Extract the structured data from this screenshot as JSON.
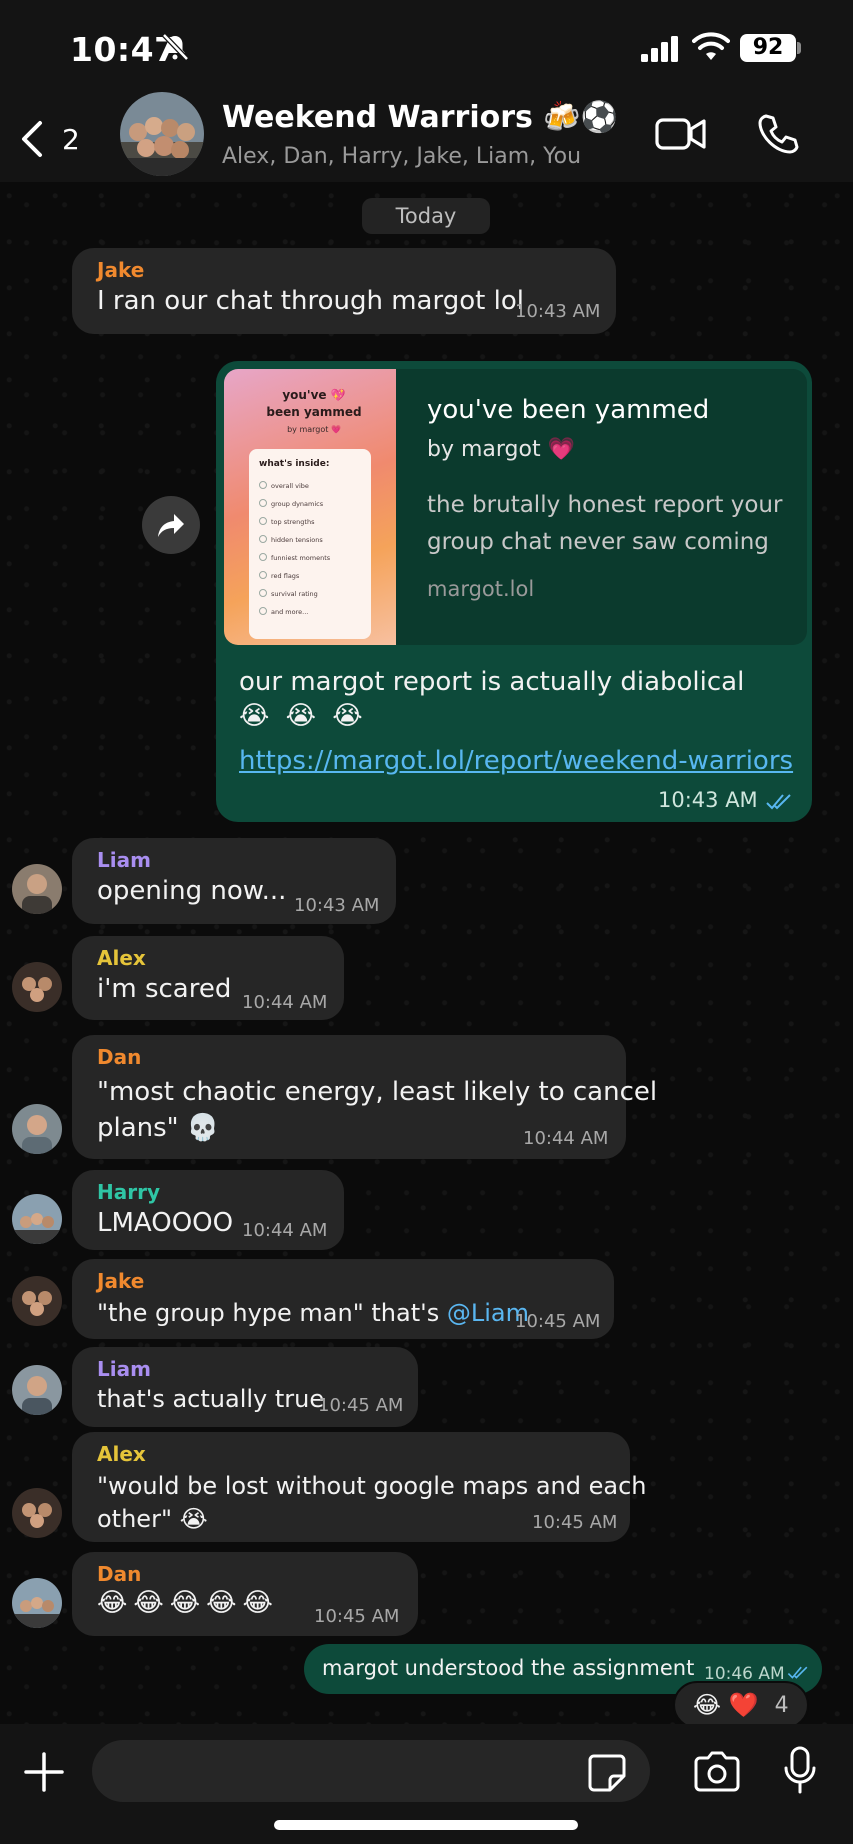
{
  "status_bar": {
    "time": "10:47",
    "battery": "92"
  },
  "header": {
    "back_count": "2",
    "title": "Weekend Warriors 🍻⚽",
    "members": "Alex, Dan, Harry, Jake, Liam, You"
  },
  "date_chip": "Today",
  "messages": [
    {
      "sender": "Jake",
      "text": "I ran our chat through margot lol",
      "time": "10:43 AM"
    },
    {
      "outgoing": true,
      "preview": {
        "thumb_title": "you've 💖 been yammed",
        "thumb_sub": "by margot 💗",
        "thumb_heading": "what's inside:",
        "thumb_items": [
          "overall vibe",
          "group dynamics",
          "top strengths",
          "hidden tensions",
          "funniest moments",
          "red flags",
          "survival rating",
          "and more..."
        ],
        "title": "you've been yammed",
        "by": "by margot 💗",
        "description": "the brutally honest report your group chat never saw coming",
        "domain": "margot.lol"
      },
      "text": "our margot report is actually diabolical",
      "emojis": "😭 😭 😭",
      "link": "https://margot.lol/report/weekend-warriors",
      "time": "10:43 AM"
    },
    {
      "sender": "Liam",
      "text": "opening now...",
      "time": "10:43 AM"
    },
    {
      "sender": "Alex",
      "text": "i'm scared",
      "time": "10:44 AM"
    },
    {
      "sender": "Dan",
      "line1": "\"most chaotic energy, least likely to cancel",
      "line2": "plans\" 💀",
      "time": "10:44 AM"
    },
    {
      "sender": "Harry",
      "text": "LMAOOOO",
      "time": "10:44 AM"
    },
    {
      "sender": "Jake",
      "text": "\"the group hype man\" that's ",
      "mention": "@Liam",
      "time": "10:45 AM"
    },
    {
      "sender": "Liam",
      "text": "that's actually true",
      "time": "10:45 AM"
    },
    {
      "sender": "Alex",
      "line1": "\"would be lost without google maps and each",
      "line2": "other\" 😭",
      "time": "10:45 AM"
    },
    {
      "sender": "Dan",
      "text": "😂😂😂😂😂",
      "time": "10:45 AM"
    },
    {
      "outgoing": true,
      "text": "margot understood the assignment",
      "time": "10:46 AM",
      "reactions": "😂 ❤️",
      "reaction_count": "4"
    }
  ],
  "colors": {
    "jake": "#f0892e",
    "liam": "#a98ef0",
    "alex": "#e5c43a",
    "dan": "#f0892e",
    "harry": "#2fc5a5",
    "outgoing_bubble": "#0d4a3a",
    "incoming_bubble": "#262626",
    "link": "#58b7f0"
  },
  "icons": [
    "bell-slash-icon",
    "signal-icon",
    "wifi-icon",
    "back-chevron-icon",
    "video-camera-icon",
    "phone-icon",
    "forward-icon",
    "read-checks-icon",
    "plus-icon",
    "sticker-icon",
    "camera-icon",
    "microphone-icon"
  ],
  "input": {
    "placeholder": ""
  }
}
